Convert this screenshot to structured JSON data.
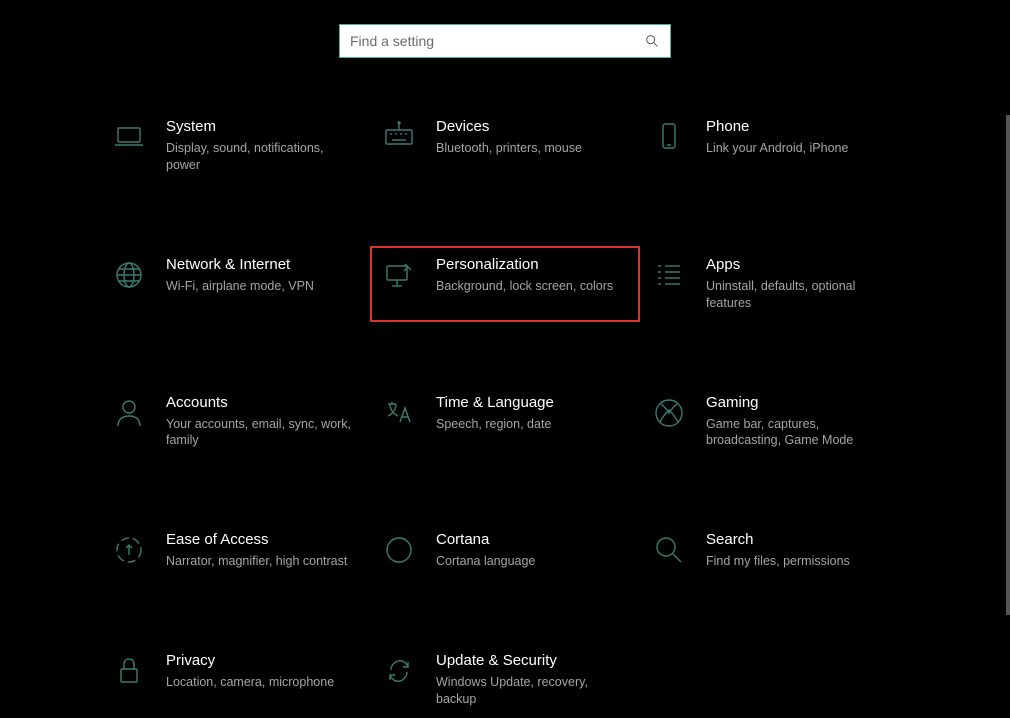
{
  "search": {
    "placeholder": "Find a setting"
  },
  "tiles": [
    {
      "id": "system",
      "title": "System",
      "desc": "Display, sound, notifications, power",
      "icon": "laptop",
      "highlighted": false
    },
    {
      "id": "devices",
      "title": "Devices",
      "desc": "Bluetooth, printers, mouse",
      "icon": "keyboard",
      "highlighted": false
    },
    {
      "id": "phone",
      "title": "Phone",
      "desc": "Link your Android, iPhone",
      "icon": "phone",
      "highlighted": false
    },
    {
      "id": "network",
      "title": "Network & Internet",
      "desc": "Wi-Fi, airplane mode, VPN",
      "icon": "globe",
      "highlighted": false
    },
    {
      "id": "personalization",
      "title": "Personalization",
      "desc": "Background, lock screen, colors",
      "icon": "paint",
      "highlighted": true
    },
    {
      "id": "apps",
      "title": "Apps",
      "desc": "Uninstall, defaults, optional features",
      "icon": "list",
      "highlighted": false
    },
    {
      "id": "accounts",
      "title": "Accounts",
      "desc": "Your accounts, email, sync, work, family",
      "icon": "person",
      "highlighted": false
    },
    {
      "id": "time-language",
      "title": "Time & Language",
      "desc": "Speech, region, date",
      "icon": "lang",
      "highlighted": false
    },
    {
      "id": "gaming",
      "title": "Gaming",
      "desc": "Game bar, captures, broadcasting, Game Mode",
      "icon": "xbox",
      "highlighted": false
    },
    {
      "id": "ease-of-access",
      "title": "Ease of Access",
      "desc": "Narrator, magnifier, high contrast",
      "icon": "ease",
      "highlighted": false
    },
    {
      "id": "cortana",
      "title": "Cortana",
      "desc": "Cortana language",
      "icon": "cortana",
      "highlighted": false
    },
    {
      "id": "search",
      "title": "Search",
      "desc": "Find my files, permissions",
      "icon": "search-big",
      "highlighted": false
    },
    {
      "id": "privacy",
      "title": "Privacy",
      "desc": "Location, camera, microphone",
      "icon": "lock",
      "highlighted": false
    },
    {
      "id": "update",
      "title": "Update & Security",
      "desc": "Windows Update, recovery, backup",
      "icon": "sync",
      "highlighted": false
    }
  ]
}
